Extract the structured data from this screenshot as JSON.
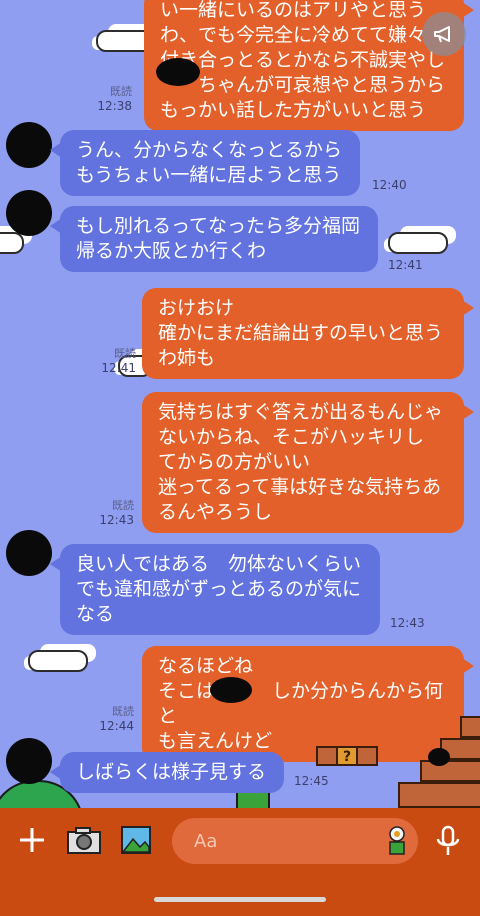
{
  "messages": [
    {
      "side": "out",
      "text": "い一緒にいるのはアリやと思う\nわ、でも今完全に冷めてて嫌々\n付き合っとるとかなら不誠実やし\n　　ちゃんが可哀想やと思うから\nもっかい話した方がいいと思う",
      "read": "既読",
      "time": "12:38"
    },
    {
      "side": "in",
      "text": "うん、分からなくなっとるから\nもうちょい一緒に居ようと思う",
      "time": "12:40"
    },
    {
      "side": "in",
      "text": "もし別れるってなったら多分福岡\n帰るか大阪とか行くわ",
      "time": "12:41"
    },
    {
      "side": "out",
      "text": "おけおけ\n確かにまだ結論出すの早いと思う\nわ姉も",
      "read": "既読",
      "time": "12:41"
    },
    {
      "side": "out",
      "text": "気持ちはすぐ答えが出るもんじゃ\nないからね、そこがハッキリし\nてからの方がいい\n迷ってるって事は好きな気持ちあ\nるんやろうし",
      "read": "既読",
      "time": "12:43"
    },
    {
      "side": "in",
      "text": "良い人ではある　勿体ないくらい\nでも違和感がずっとあるのが気に\nなる",
      "time": "12:43"
    },
    {
      "side": "out",
      "text": "なるほどね\nそこは　　　しか分からんから何と\nも言えんけど",
      "read": "既読",
      "time": "12:44"
    },
    {
      "side": "in",
      "text": "しばらくは様子見する",
      "time": "12:45"
    }
  ],
  "input": {
    "placeholder": "Aa"
  },
  "icons": {
    "plus": "plus-icon",
    "camera": "camera-icon",
    "image": "image-icon",
    "sticker": "sticker-icon",
    "mic": "microphone-icon",
    "announce": "megaphone-icon"
  },
  "colors": {
    "background": "#8f9ef0",
    "outgoing": "#e3602a",
    "incoming": "#6272de",
    "bar": "#c94b12"
  }
}
